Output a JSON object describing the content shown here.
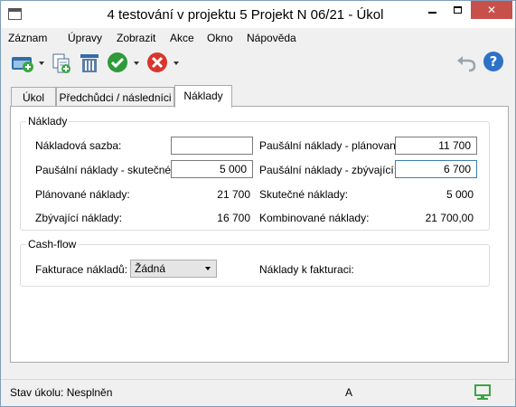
{
  "window": {
    "title": "4 testování v projektu 5 Projekt  N 06/21 - Úkol",
    "minimize_glyph": "",
    "maximize_glyph": "",
    "close_glyph": "✕"
  },
  "menu": [
    "Záznam",
    "Úpravy",
    "Zobrazit",
    "Akce",
    "Okno",
    "Nápověda"
  ],
  "toolbar": {
    "icons": [
      "new-record-icon",
      "copy-record-icon",
      "delete-record-icon",
      "confirm-icon",
      "cancel-icon",
      "undo-icon",
      "help-icon"
    ],
    "help_glyph": "?",
    "undo_glyph": "↶"
  },
  "tabs": [
    {
      "label": "Úkol",
      "active": false
    },
    {
      "label": "Předchůdci / následníci",
      "active": false
    },
    {
      "label": "Náklady",
      "active": true
    }
  ],
  "costs": {
    "group_label": "Náklady",
    "rate_label": "Nákladová sazba:",
    "rate_value": "",
    "flat_actual_label": "Paušální náklady - skutečné:",
    "flat_actual_value": "5 000",
    "planned_label": "Plánované náklady:",
    "planned_value": "21 700",
    "remaining_label": "Zbývající náklady:",
    "remaining_value": "16 700",
    "flat_planned_label": "Paušální náklady - plánované:",
    "flat_planned_value": "11 700",
    "flat_remaining_label": "Paušální náklady - zbývající:",
    "flat_remaining_value": "6 700",
    "actual_label": "Skutečné náklady:",
    "actual_value": "5 000",
    "combined_label": "Kombinované náklady:",
    "combined_value": "21 700,00"
  },
  "cashflow": {
    "group_label": "Cash-flow",
    "invoicing_label": "Fakturace nákladů:",
    "invoicing_value": "Žádná",
    "to_invoice_label": "Náklady k fakturaci:"
  },
  "status": {
    "task_status": "Stav úkolu: Nesplněn",
    "indicator": "A"
  },
  "colors": {
    "confirm": "#2e9a3a",
    "cancel": "#d9352d",
    "help": "#2c72c7",
    "close": "#c7504b"
  }
}
